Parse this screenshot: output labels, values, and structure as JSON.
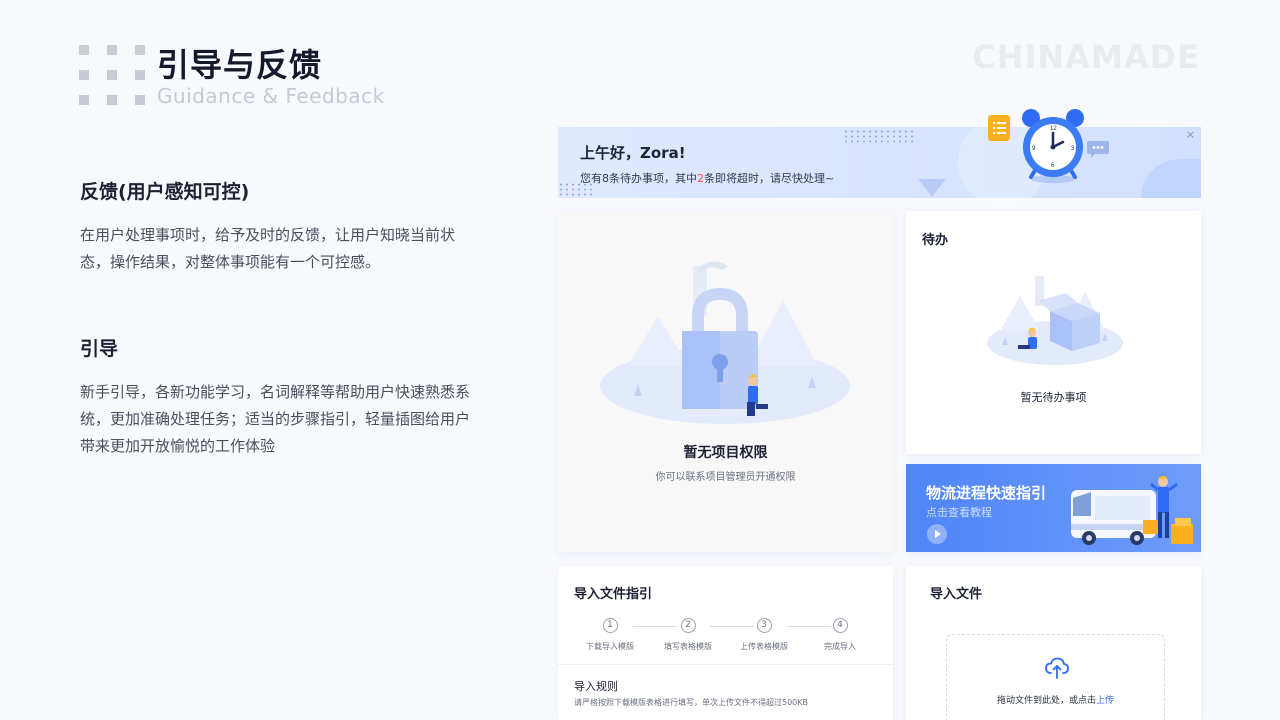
{
  "header": {
    "title_zh": "引导与反馈",
    "title_en": "Guidance & Feedback",
    "brand": "CHINAMADE"
  },
  "sections": {
    "feedback": {
      "title": "反馈(用户感知可控)",
      "body": "在用户处理事项时，给予及时的反馈，让用户知晓当前状态，操作结果，对整体事项能有一个可控感。"
    },
    "guide": {
      "title": "引导",
      "body": "新手引导，各新功能学习，名词解释等帮助用户快速熟悉系统，更加准确处理任务；适当的步骤指引，轻量插图给用户带来更加开放愉悦的工作体验"
    }
  },
  "banner": {
    "greeting": "上午好，Zora!",
    "sub_prefix": "您有8条待办事项，其中",
    "sub_highlight": "2",
    "sub_suffix": "条即将超时，请尽快处理~",
    "close": "×"
  },
  "no_permission": {
    "title": "暂无项目权限",
    "subtitle": "你可以联系项目管理员开通权限"
  },
  "todo": {
    "header": "待办",
    "empty": "暂无待办事项"
  },
  "logistics": {
    "title": "物流进程快速指引",
    "subtitle": "点击查看教程"
  },
  "import_guide": {
    "header": "导入文件指引",
    "steps": [
      {
        "n": "1",
        "label": "下载导入模版"
      },
      {
        "n": "2",
        "label": "填写表格模版"
      },
      {
        "n": "3",
        "label": "上传表格模版"
      },
      {
        "n": "4",
        "label": "完成导入"
      }
    ],
    "rules_title": "导入规则",
    "rules_desc": "请严格按照下载模版表格进行填写，单次上传文件不得超过500KB"
  },
  "import_file": {
    "header": "导入文件",
    "drop_prefix": "拖动文件到此处，或点击",
    "drop_link": "上传"
  },
  "colors": {
    "accent": "#4f85f7",
    "highlight": "#ff4b4b",
    "link": "#2f6bf3"
  },
  "icons": {
    "logo": "grid-logo-icon",
    "alarm": "alarm-clock-icon",
    "note": "note-icon",
    "chat": "chat-bubble-icon",
    "lock": "lock-illustration",
    "box": "box-illustration",
    "van": "van-illustration",
    "play": "play-icon",
    "upload": "cloud-upload-icon"
  }
}
